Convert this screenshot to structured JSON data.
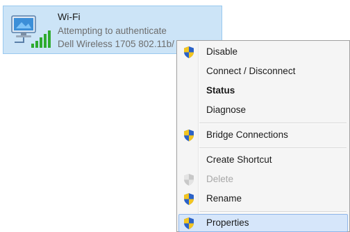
{
  "adapter": {
    "name": "Wi-Fi",
    "status": "Attempting to authenticate",
    "device": "Dell Wireless 1705 802.11b/"
  },
  "context_menu": {
    "items": [
      {
        "label": "Disable",
        "shield": true
      },
      {
        "label": "Connect / Disconnect",
        "shield": false
      },
      {
        "label": "Status",
        "shield": false,
        "bold": true
      },
      {
        "label": "Diagnose",
        "shield": false
      },
      {
        "label": "Bridge Connections",
        "shield": true
      },
      {
        "label": "Create Shortcut",
        "shield": false
      },
      {
        "label": "Delete",
        "shield": true,
        "disabled": true
      },
      {
        "label": "Rename",
        "shield": true
      },
      {
        "label": "Properties",
        "shield": true,
        "highlighted": true
      }
    ]
  },
  "colors": {
    "tile_background": "#cce4f7",
    "menu_background": "#f5f5f5",
    "highlight": "#d6e6fa",
    "shield_blue": "#2b62c8",
    "shield_yellow": "#f3c520",
    "signal_green": "#2eab2e"
  }
}
